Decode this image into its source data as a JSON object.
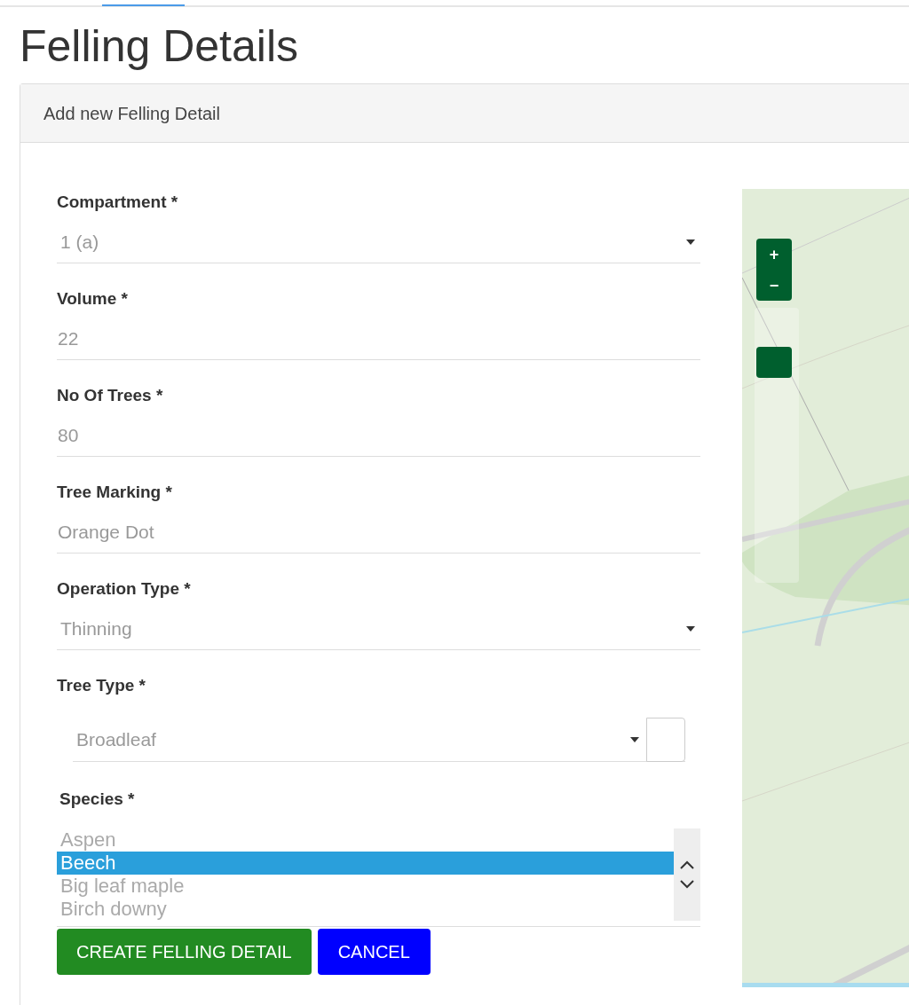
{
  "page_title": "Felling Details",
  "panel": {
    "heading": "Add new Felling Detail",
    "fields": [
      {
        "label": "Compartment *",
        "value": "1 (a)",
        "kind": "select"
      },
      {
        "label": "Volume *",
        "value": "22",
        "kind": "text"
      },
      {
        "label": "No Of Trees *",
        "value": "80",
        "kind": "text"
      },
      {
        "label": "Tree Marking *",
        "value": "Orange Dot",
        "kind": "text"
      },
      {
        "label": "Operation Type *",
        "value": "Thinning",
        "kind": "select"
      },
      {
        "label": "Tree Type *",
        "value": "Broadleaf",
        "kind": "boxed-select"
      }
    ],
    "species": {
      "label": "Species *",
      "options": [
        {
          "text": "Aspen",
          "selected": false
        },
        {
          "text": "Beech",
          "selected": true
        },
        {
          "text": "Big leaf maple",
          "selected": false
        },
        {
          "text": "Birch downy",
          "selected": false
        }
      ]
    },
    "buttons": [
      {
        "label": "CREATE FELLING DETAIL",
        "kind": "primary"
      },
      {
        "label": "CANCEL",
        "kind": "secondary"
      }
    ],
    "map": {
      "zoom_in": "+",
      "zoom_out": "−"
    }
  }
}
